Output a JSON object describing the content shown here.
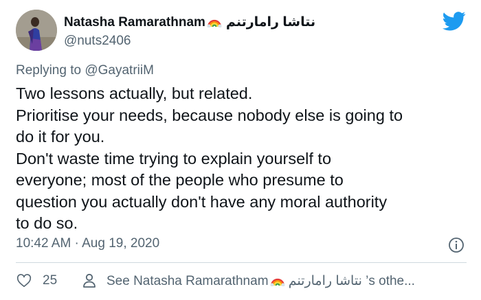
{
  "author": {
    "name": "Natasha Ramarathnam",
    "name_arabic": "نتاشا رامارتنم",
    "handle": "@nuts2406",
    "avatar_icon": "avatar-photo"
  },
  "reply": {
    "prefix": "Replying to",
    "mention": "@GayatriiM"
  },
  "tweet": {
    "lines": [
      "Two lessons actually, but related.",
      "Prioritise your needs, because nobody else is going to",
      "do it for you.",
      "Don't waste time trying to explain yourself to",
      "everyone; most of the people who presume to",
      "question you actually don't have any moral authority",
      "to do so."
    ]
  },
  "meta": {
    "timestamp": "10:42 AM · Aug 19, 2020"
  },
  "actions": {
    "likes": "25",
    "see_prefix": "See Natasha Ramarathnam",
    "see_arabic": "نتاشا رامارتنم",
    "see_suffix": "’s othe..."
  },
  "colors": {
    "twitter_blue": "#1d9bf0",
    "secondary_text": "#536471",
    "divider": "#cfd9de"
  },
  "icons": [
    "rainbow-emoji",
    "twitter-bird-icon",
    "info-icon",
    "heart-icon",
    "person-icon"
  ]
}
